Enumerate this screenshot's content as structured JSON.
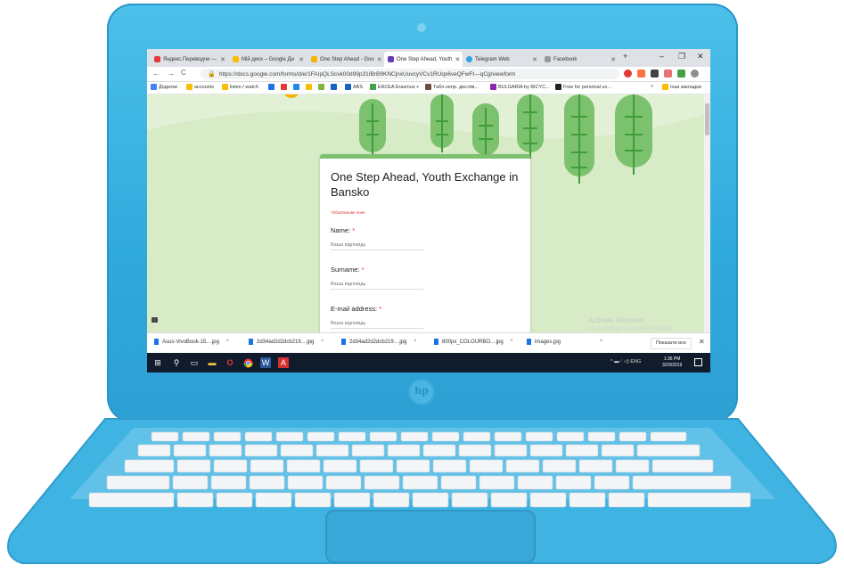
{
  "browser": {
    "tabs": [
      {
        "label": "Яндекс.Переводчи —",
        "color": "#e53935"
      },
      {
        "label": "Мій диск – Google Ди",
        "color": "#fbbc04"
      },
      {
        "label": "One Step Ahead - Goo",
        "color": "#f4b400"
      },
      {
        "label": "One Step Ahead, Youth",
        "color": "#673ab7"
      },
      {
        "label": "Telegram Web",
        "color": "#2ca5e0"
      },
      {
        "label": "Facebook",
        "color": "#999999"
      }
    ],
    "new_tab": "+",
    "controls": {
      "minimize": "–",
      "maximize": "❐",
      "close": "✕"
    },
    "url": "https://docs.google.com/forms/d/e/1FAIpQLScvk00d99p31IBrB9KNCjnxUuvcyVCv1RUqx6veQFwFt—qCg/viewform",
    "nav": {
      "back": "←",
      "forward": "→",
      "reload": "C"
    },
    "bookmarks": [
      {
        "label": "Додатки",
        "color": "#4285f4"
      },
      {
        "label": "accounts",
        "color": "#fbbc04"
      },
      {
        "label": "listen / watch",
        "color": "#fbbc04"
      },
      {
        "label": "",
        "color": "#1a73e8"
      },
      {
        "label": "",
        "color": "#e53935"
      },
      {
        "label": "",
        "color": "#1e88e5"
      },
      {
        "label": "",
        "color": "#fbbc04"
      },
      {
        "label": "",
        "color": "#7cb342"
      },
      {
        "label": "",
        "color": "#1565c0"
      },
      {
        "label": "ABS",
        "color": "#1565c0"
      },
      {
        "label": "EACEA Erasmus +",
        "color": "#43a047"
      },
      {
        "label": "Табл.непр. дієслів...",
        "color": "#6d4c41"
      },
      {
        "label": "BULGARIA by BICYC...",
        "color": "#8e24aa"
      },
      {
        "label": "Free for personal us...",
        "color": "#222222"
      }
    ],
    "bookmarks_more": "»",
    "other_bookmarks": "Інші закладки"
  },
  "form": {
    "title": "One Step Ahead, Youth Exchange in Bansko",
    "required_note": "*Обов'язкове поле",
    "questions": [
      {
        "label": "Name:",
        "placeholder": "Ваша відповідь"
      },
      {
        "label": "Surname:",
        "placeholder": "Ваша відповідь"
      },
      {
        "label": "E-mail address:",
        "placeholder": "Ваша відповідь"
      }
    ],
    "required_mark": "*"
  },
  "watermark": {
    "title": "Activate Windows",
    "subtitle": "Go to Settings to activate Windows."
  },
  "downloads": {
    "items": [
      "Asus-VivoBook-15....jpg",
      "2d34ad2d2dcb219....jpg",
      "2d34ad2d2dcb219....jpg",
      "800px_COLOURBO....jpg",
      "images.jpg"
    ],
    "show_all": "Показати все",
    "close": "✕"
  },
  "taskbar": {
    "lang": "ENG",
    "time": "1:36 PM",
    "date": "3/29/2019"
  },
  "laptop": {
    "logo": "hp"
  },
  "colors": {
    "lid": "#36b0e0",
    "form_accent": "#7cc26e",
    "page_bg": "#e2f1d6"
  }
}
